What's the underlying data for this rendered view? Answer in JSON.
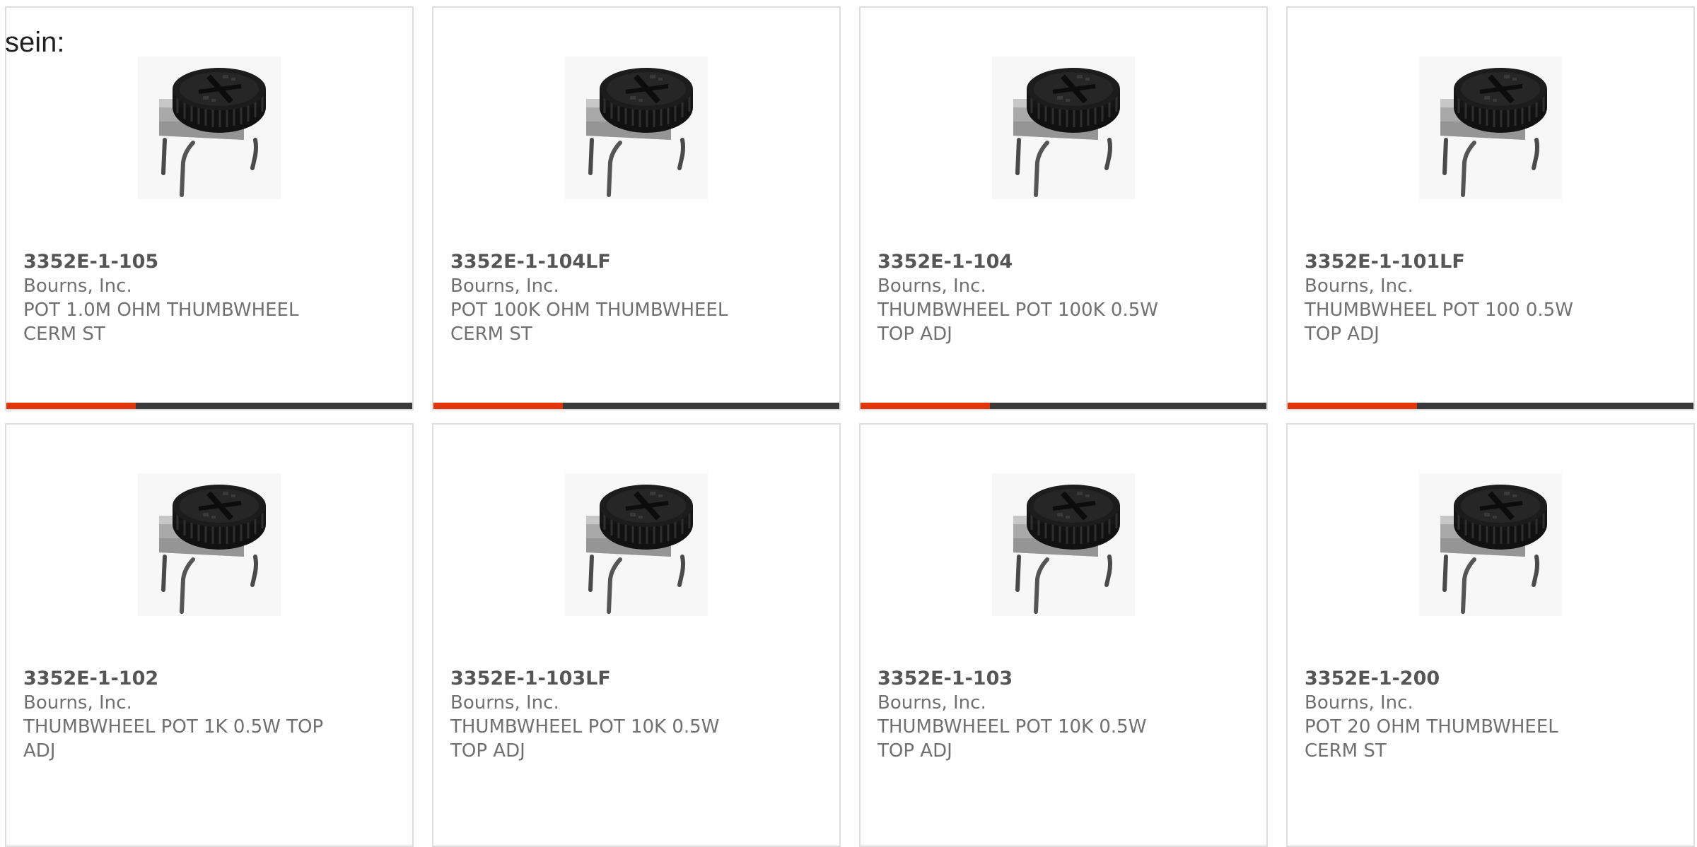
{
  "intro_text": "sein:",
  "colors": {
    "accent": "#e2350a",
    "bar": "#3a3a3a",
    "border": "#dedede",
    "text": "#707070"
  },
  "product_image_icon": "thumbwheel-potentiometer-image",
  "products": [
    {
      "part_number": "3352E-1-105",
      "manufacturer": "Bourns, Inc.",
      "description_line1": "POT 1.0M OHM THUMBWHEEL",
      "description_line2": "CERM ST"
    },
    {
      "part_number": "3352E-1-104LF",
      "manufacturer": "Bourns, Inc.",
      "description_line1": "POT 100K OHM THUMBWHEEL",
      "description_line2": "CERM ST"
    },
    {
      "part_number": "3352E-1-104",
      "manufacturer": "Bourns, Inc.",
      "description_line1": "THUMBWHEEL POT 100K 0.5W",
      "description_line2": "TOP ADJ"
    },
    {
      "part_number": "3352E-1-101LF",
      "manufacturer": "Bourns, Inc.",
      "description_line1": "THUMBWHEEL POT 100 0.5W",
      "description_line2": "TOP ADJ"
    },
    {
      "part_number": "3352E-1-102",
      "manufacturer": "Bourns, Inc.",
      "description_line1": "THUMBWHEEL POT 1K 0.5W TOP",
      "description_line2": "ADJ"
    },
    {
      "part_number": "3352E-1-103LF",
      "manufacturer": "Bourns, Inc.",
      "description_line1": "THUMBWHEEL POT 10K 0.5W",
      "description_line2": "TOP ADJ"
    },
    {
      "part_number": "3352E-1-103",
      "manufacturer": "Bourns, Inc.",
      "description_line1": "THUMBWHEEL POT 10K 0.5W",
      "description_line2": "TOP ADJ"
    },
    {
      "part_number": "3352E-1-200",
      "manufacturer": "Bourns, Inc.",
      "description_line1": "POT 20 OHM THUMBWHEEL",
      "description_line2": "CERM ST"
    }
  ]
}
